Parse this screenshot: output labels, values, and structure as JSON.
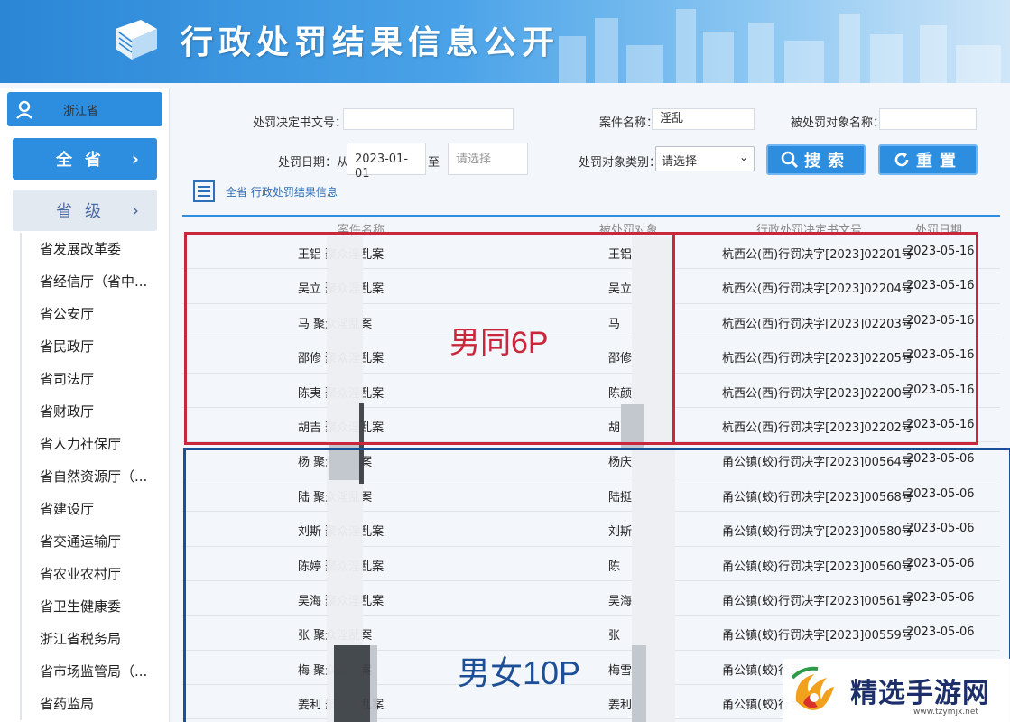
{
  "header": {
    "title": "行政处罚结果信息公开"
  },
  "sidebar": {
    "province": "浙江省",
    "all_label": "全省",
    "provincial_label": "省级",
    "chevron": "›",
    "items": [
      "省发展改革委",
      "省经信厅（省中...",
      "省公安厅",
      "省民政厅",
      "省司法厅",
      "省财政厅",
      "省人力社保厅",
      "省自然资源厅（...",
      "省建设厅",
      "省交通运输厅",
      "省农业农村厅",
      "省卫生健康委",
      "浙江省税务局",
      "省市场监管局（...",
      "省药监局"
    ]
  },
  "search": {
    "doc_no_label": "处罚决定书文号：",
    "doc_no_value": "",
    "case_name_label": "案件名称：",
    "case_name_value": "淫乱",
    "target_name_label": "被处罚对象名称：",
    "target_name_value": "",
    "date_label": "处罚日期：从",
    "date_from": "2023-01-01",
    "date_to_label": "至",
    "date_to_placeholder": "请选择",
    "type_label": "处罚对象类别：",
    "type_value": "请选择",
    "search_button": "搜索",
    "reset_button": "重置"
  },
  "breadcrumb": "全省 行政处罚结果信息",
  "table": {
    "columns": [
      "案件名称",
      "被处罚对象",
      "行政处罚决定书文号",
      "处罚日期"
    ],
    "rows": [
      {
        "case": "王铝  聚众淫乱案",
        "target": "王铝",
        "doc": "杭西公(西)行罚决字[2023]02201号",
        "date": "2023-05-16"
      },
      {
        "case": "吴立  聚众淫乱案",
        "target": "吴立",
        "doc": "杭西公(西)行罚决字[2023]02204号",
        "date": "2023-05-16"
      },
      {
        "case": "马   聚众淫乱案",
        "target": "马",
        "doc": "杭西公(西)行罚决字[2023]02203号",
        "date": "2023-05-16"
      },
      {
        "case": "邵修  聚众淫乱案",
        "target": "邵修",
        "doc": "杭西公(西)行罚决字[2023]02205号",
        "date": "2023-05-16"
      },
      {
        "case": "陈夷  聚众淫乱案",
        "target": "陈颜",
        "doc": "杭西公(西)行罚决字[2023]02200号",
        "date": "2023-05-16"
      },
      {
        "case": "胡吉  聚众淫乱案",
        "target": "胡",
        "doc": "杭西公(西)行罚决字[2023]02202号",
        "date": "2023-05-16"
      },
      {
        "case": "杨   聚众淫乱案",
        "target": "杨庆",
        "doc": "甬公镇(蛟)行罚决字[2023]00564号",
        "date": "2023-05-06"
      },
      {
        "case": "陆   聚众淫乱案",
        "target": "陆挺",
        "doc": "甬公镇(蛟)行罚决字[2023]00568号",
        "date": "2023-05-06"
      },
      {
        "case": "刘斯  聚众淫乱案",
        "target": "刘斯",
        "doc": "甬公镇(蛟)行罚决字[2023]00580号",
        "date": "2023-05-06"
      },
      {
        "case": "陈婷  聚众淫乱案",
        "target": "陈",
        "doc": "甬公镇(蛟)行罚决字[2023]00560号",
        "date": "2023-05-06"
      },
      {
        "case": "吴海  聚众淫乱案",
        "target": "吴海",
        "doc": "甬公镇(蛟)行罚决字[2023]00561号",
        "date": "2023-05-06"
      },
      {
        "case": "张   聚众淫乱案",
        "target": "张",
        "doc": "甬公镇(蛟)行罚决字[2023]00559号",
        "date": "2023-05-06"
      },
      {
        "case": "梅   聚众淫乱案",
        "target": "梅雪",
        "doc": "甬公镇(蛟)行罚",
        "date": ""
      },
      {
        "case": "姜利  聚众淫乱案",
        "target": "姜利",
        "doc": "甬公镇(蛟)行罚",
        "date": ""
      }
    ]
  },
  "annotations": {
    "red": "男同6P",
    "blue": "男女10P"
  },
  "watermark": {
    "name": "精选手游网",
    "url": "www.tzymjx.net"
  }
}
